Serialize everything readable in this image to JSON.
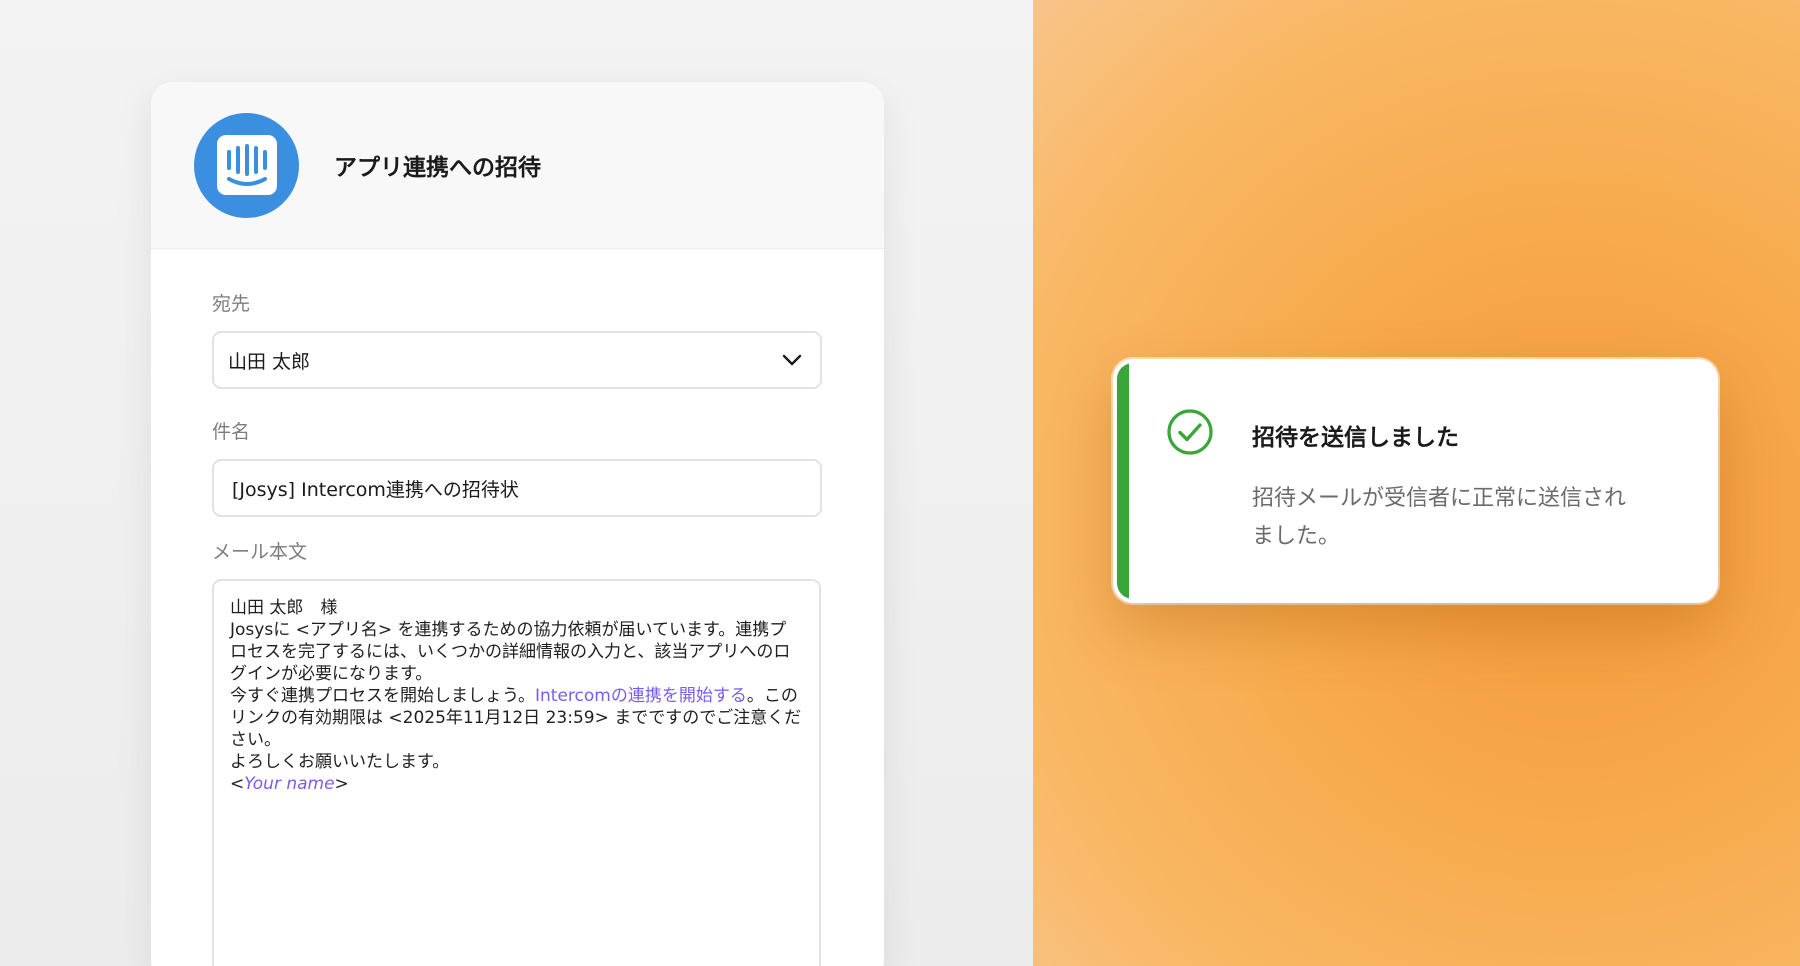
{
  "invite_card": {
    "title": "アプリ連携への招待",
    "app_icon": "intercom-logo-icon",
    "recipient": {
      "label": "宛先",
      "value": "山田 太郎"
    },
    "subject": {
      "label": "件名",
      "value": "[Josys] Intercom連携への招待状"
    },
    "body": {
      "label": "メール本文",
      "greeting": "山田 太郎　様",
      "paragraph1": "Josysに <アプリ名> を連携するための協力依頼が届いています。連携プロセスを完了するには、いくつかの詳細情報の入力と、該当アプリへのログインが必要になります。",
      "paragraph2_prefix": "今すぐ連携プロセスを開始しましょう。",
      "paragraph2_link": "Intercomの連携を開始する",
      "paragraph2_suffix": "。このリンクの有効期限は <2025年11月12日 23:59> までですのでご注意ください。",
      "closing": "よろしくお願いいたします。",
      "signature_open": "<",
      "signature_name": "Your name",
      "signature_close": ">"
    }
  },
  "toast": {
    "title": "招待を送信しました",
    "message": "招待メールが受信者に正常に送信されました。",
    "icon": "check-circle-icon",
    "accent_color": "#3aa63a"
  },
  "colors": {
    "link": "#7b5bf5",
    "app_logo": "#3b8fe0",
    "background_right": "#f8aa4c"
  }
}
